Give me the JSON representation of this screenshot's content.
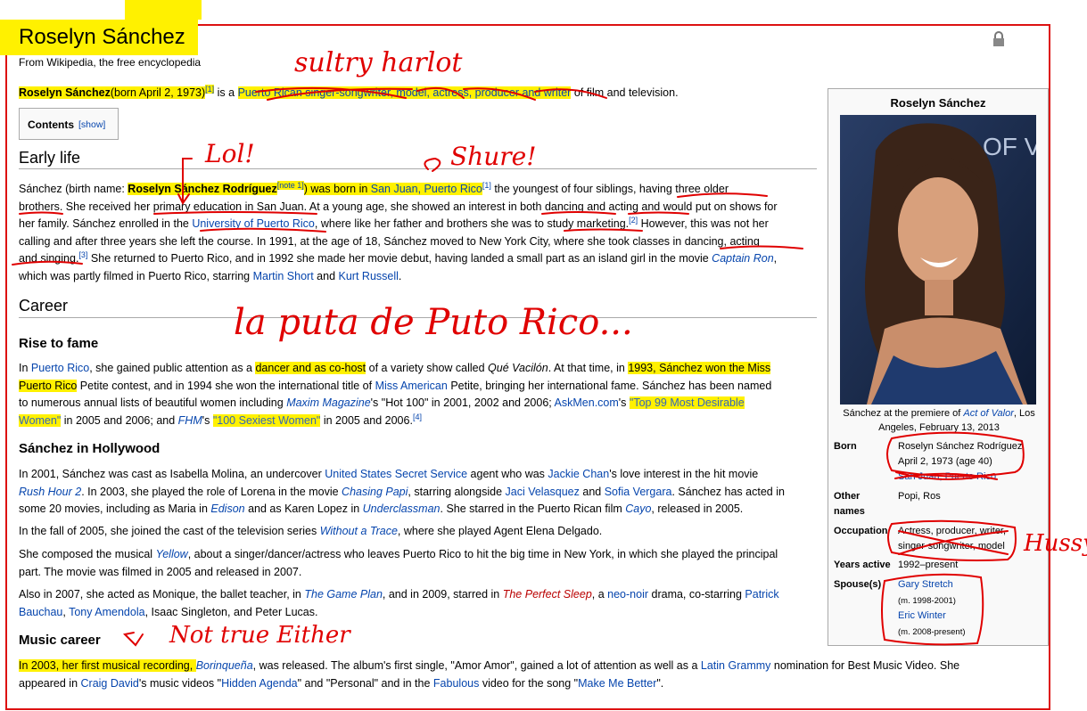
{
  "page": {
    "title": "Roselyn Sánchez",
    "subtitle": "From Wikipedia, the free encyclopedia",
    "lock_icon": "lock-icon"
  },
  "intro": {
    "name": "Roselyn Sánchez",
    "born": "(born April 2, 1973)",
    "ref1": "[1]",
    "is_a": " is a ",
    "occupations": "Puerto Rican singer-songwriter, model, actress, producer and writer",
    "tail": " of film and television."
  },
  "toc": {
    "label": "Contents",
    "show": "[show]"
  },
  "sections": {
    "early_life": "Early life",
    "career": "Career",
    "rise": "Rise to fame",
    "hollywood": "Sánchez in Hollywood",
    "music": "Music career"
  },
  "early": {
    "l1a": "Sánchez (birth name: ",
    "birthname": "Roselyn Sánchez Rodríguez",
    "note": "[note 1]",
    "l1b": ") was born in ",
    "sanjuan": "San Juan, Puerto Rico",
    "ref": "[1]",
    "l1c": " the youngest of four siblings, having three older",
    "l2a": "brothers. She received her primary education in San Juan. At a young age, she showed an interest in both dancing and acting and would put on shows for",
    "l3a": "her family. Sánchez enrolled in the ",
    "upr": "University of Puerto Rico",
    "l3b": ", where like her father and brothers she was to study marketing.",
    "ref2": "[2]",
    "l3c": " However, this was not her",
    "l4": "calling and after three years she left the course. In 1991, at the age of 18, Sánchez moved to New York City, where she took classes in dancing, acting",
    "l5a": "and singing.",
    "ref3": "[3]",
    "l5b": " She returned to Puerto Rico, and in 1992 she made her movie debut, having landed a small part as an island girl in the movie ",
    "captainron": "Captain Ron",
    "l5c": ",",
    "l6a": "which was partly filmed in Puerto Rico, starring ",
    "martin": "Martin Short",
    "and": " and ",
    "kurt": "Kurt Russell",
    "dot": "."
  },
  "rise": {
    "l1a": "In ",
    "pr": "Puerto Rico",
    "l1b": ", she gained public attention as a ",
    "dancer": "dancer and as co-host",
    "l1c": " of a variety show called ",
    "vacilon": "Qué Vacilón",
    "l1d": ". At that time, in ",
    "won": "1993, Sánchez won the Miss",
    "l2a": "Puerto Rico",
    "l2b": " Petite contest, and in 1994 she won the international title of ",
    "missam": "Miss American",
    "l2c": " Petite, bringing her international fame. Sánchez has been named",
    "l3a": "to numerous annual lists of beautiful women including ",
    "maxim": "Maxim Magazine",
    "l3b": "'s \"Hot 100\" in 2001, 2002 and 2006; ",
    "askmen": "AskMen.com",
    "l3c": "'s ",
    "top99": "\"Top 99 Most Desirable",
    "l4a": "Women\"",
    "l4b": " in 2005 and 2006; and ",
    "fhm": "FHM",
    "l4c": "'s ",
    "sexiest": "\"100 Sexiest Women\"",
    "l4d": " in 2005 and 2006.",
    "ref4": "[4]"
  },
  "hollywood": {
    "p1l1a": "In 2001, Sánchez was cast as Isabella Molina, an undercover ",
    "usss": "United States Secret Service",
    "p1l1b": " agent who was ",
    "jackie": "Jackie Chan",
    "p1l1c": "'s love interest in the hit movie",
    "rush": "Rush Hour 2",
    "p1l2a": ". In 2003, she played the role of Lorena in the movie ",
    "chasing": "Chasing Papi",
    "p1l2b": ", starring alongside ",
    "jaci": "Jaci Velasquez",
    "p1l2c": " and ",
    "sofia": "Sofia Vergara",
    "p1l2d": ". Sánchez has acted in",
    "p1l3a": "some 20 movies, including as Maria in ",
    "edison": "Edison",
    "p1l3b": " and as Karen Lopez in ",
    "under": "Underclassman",
    "p1l3c": ". She starred in the Puerto Rican film ",
    "cayo": "Cayo",
    "p1l3d": ", released in 2005.",
    "p2a": "In the fall of 2005, she joined the cast of the television series ",
    "trace": "Without a Trace",
    "p2b": ", where she played Agent Elena Delgado.",
    "p3l1a": "She composed the musical ",
    "yellow": "Yellow",
    "p3l1b": ", about a singer/dancer/actress who leaves Puerto Rico to hit the big time in New York, in which she played the principal",
    "p3l2": "part. The movie was filmed in 2005 and released in 2007.",
    "p4l1a": "Also in 2007, she acted as Monique, the ballet teacher, in ",
    "gameplan": "The Game Plan",
    "p4l1b": ", and in 2009, starred in ",
    "sleep": "The Perfect Sleep",
    "p4l1c": ", a ",
    "neonoir": "neo-noir",
    "p4l1d": " drama, co-starring ",
    "patrick": "Patrick",
    "p4l2a": "Bauchau",
    "p4l2b": ", ",
    "tony": "Tony Amendola",
    "p4l2c": ", Isaac Singleton, and Peter Lucas."
  },
  "music": {
    "l1a": "In 2003, her first musical recording, ",
    "borinq": "Borinqueña",
    "l1b": ", was released. The album's first single, \"Amor Amor\", gained a lot of attention as well as a ",
    "grammy": "Latin Grammy",
    "l1c": " nomination for Best Music Video. She",
    "l2a": "appeared in ",
    "craig": "Craig David",
    "l2b": "'s music videos \"",
    "hidden": "Hidden Agenda",
    "l2c": "\" and \"Personal\" and in the ",
    "fabulous": "Fabulous",
    "l2d": " video for the song \"",
    "better": "Make Me Better",
    "l2e": "\"."
  },
  "infobox": {
    "title": "Roselyn Sánchez",
    "caption_a": "Sánchez at the premiere of ",
    "caption_link": "Act of Valor",
    "caption_b": ", Los Angeles, February 13, 2013",
    "photo_bg_text": "OF VALO",
    "born_label": "Born",
    "born_name": "Roselyn Sánchez Rodríguez",
    "born_date": "April 2, 1973 (age 40)",
    "born_place": "San Juan, Puerto Rico",
    "other_label": "Other names",
    "other_value": "Popi, Ros",
    "occ_label": "Occupation",
    "occ_value": "Actress, producer, writer, singer-songwriter, model",
    "years_label": "Years active",
    "years_value": "1992–present",
    "spouse_label": "Spouse(s)",
    "spouse1": "Gary Stretch",
    "spouse1_years": "(m. 1998-2001)",
    "spouse2": "Eric Winter",
    "spouse2_years": "(m. 2008-present)"
  },
  "annotations": {
    "a1": "sultry harlot",
    "a2": "Lol!",
    "a3": "Shure!",
    "a4": "la puta de Puto Rico...",
    "a5": "Hussy",
    "a6": "Not true Either"
  },
  "colors": {
    "highlight": "#fff100",
    "ink": "#e00000",
    "link": "#0645ad"
  }
}
